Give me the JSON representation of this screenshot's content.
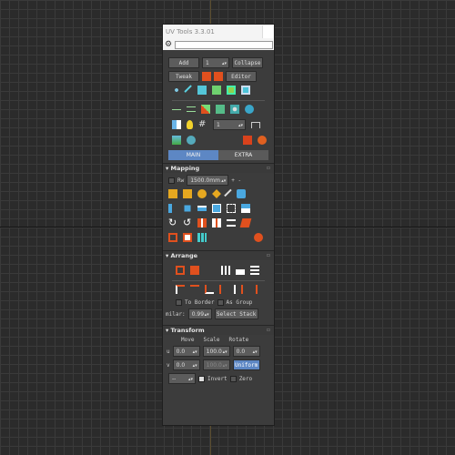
{
  "window": {
    "title": "UV Tools 3.3.01"
  },
  "toolbar": {
    "add_label": "Add",
    "channel_value": "1",
    "collapse_label": "Collapse",
    "tweak_label": "Tweak",
    "editor_label": "Editor",
    "spin_value": "1"
  },
  "tabs": {
    "main": "MAIN",
    "extra": "EXTRA"
  },
  "mapping": {
    "title": "Mapping",
    "rw_label": "Rw",
    "size_value": "1500.0mm",
    "plus_minus": "+ -"
  },
  "arrange": {
    "title": "Arrange",
    "to_border_label": "To Border",
    "as_group_label": "As Group",
    "similar_label": "milar:",
    "similar_value": "0.99",
    "select_stack_label": "Select Stack"
  },
  "transform": {
    "title": "Transform",
    "col_move": "Move",
    "col_scale": "Scale",
    "col_rotate": "Rotate",
    "u_label": "u",
    "v_label": "v",
    "u_move": "0.0",
    "u_scale": "100.0",
    "u_rotate": "0.0",
    "v_move": "0.0",
    "v_scale": "100.0",
    "uniform_label": "Uniform",
    "dropdown_value": "--",
    "invert_label": "Invert",
    "zero_label": "Zero"
  },
  "colors": {
    "accent": "#5d87c4",
    "panel": "#3c3c3c",
    "button": "#5c5c5c",
    "orange": "#e0501e"
  }
}
